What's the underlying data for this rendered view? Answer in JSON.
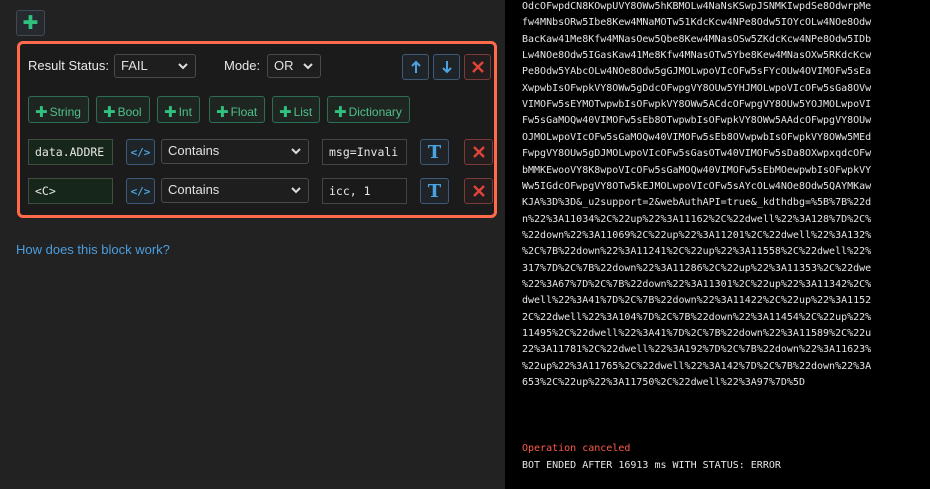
{
  "colors": {
    "accent_border": "#ff6b4a",
    "plus_green": "#2ec27e",
    "link_blue": "#4a9ee0",
    "error_red": "#ff5a4a",
    "rail": [
      "#f5c400",
      "#f5c400",
      "#27ae60",
      "#f5c400",
      "#2f8be6"
    ]
  },
  "icons": {
    "add": "plus-icon",
    "up": "arrow-up-icon",
    "down": "arrow-down-icon",
    "remove": "close-icon",
    "code": "code-icon",
    "text": "text-icon",
    "dropdown": "chevron-down-icon"
  },
  "block": {
    "result_status_label": "Result Status:",
    "result_status_value": "FAIL",
    "mode_label": "Mode:",
    "mode_value": "OR",
    "type_buttons": [
      "String",
      "Bool",
      "Int",
      "Float",
      "List",
      "Dictionary"
    ],
    "conditions": [
      {
        "variable": "data.ADDRE",
        "code_label": "</>",
        "comparison": "Contains",
        "value": "msg=Invali",
        "text_label": "T"
      },
      {
        "variable": "<C>",
        "code_label": "</>",
        "comparison": "Contains",
        "value": "icc, 1",
        "text_label": "T"
      }
    ],
    "help_link": "How does this block work?"
  },
  "console": {
    "lines": [
      "OdcOFwpdCN8KOwpUVY8OWw5hKBMOLw4NaNsKSwpJSNMKIwpdSe8OdwrpMe",
      "fw4MNbsORw5Ibe8Kew4MNaMOTw51KdcKcw4NPe8Odw5IOYcOLw4NOe8Odw",
      "BacKaw41Me8Kfw4MNasOew5Qbe8Kew4MNasOSw5ZKdcKcw4NPe8Odw5IDb",
      "Lw4NOe8Odw5IGasKaw41Me8Kfw4MNasOTw5Ybe8Kew4MNasOXw5RKdcKcw",
      "Pe8Odw5YAbcOLw4NOe8Odw5gGJMOLwpoVIcOFw5sFYcOUw4OVIMOFw5sEa",
      "XwpwbIsOFwpkVY8OWw5gDdcOFwpgVY8OUw5YHJMOLwpoVIcOFw5sGa8OVw",
      "VIMOFw5sEYMOTwpwbIsOFwpkVY8OWw5ACdcOFwpgVY8OUw5YOJMOLwpoVI",
      "Fw5sGaMOQw40VIMOFw5sEb8OTwpwbIsOFwpkVY8OWw5AAdcOFwpgVY8OUw",
      "OJMOLwpoVIcOFw5sGaMOQw40VIMOFw5sEb8OVwpwbIsOFwpkVY8OWw5MEd",
      "FwpgVY8OUw5gDJMOLwpoVIcOFw5sGasOTw40VIMOFw5sDa8OXwpxqdcOFw",
      "bMMKEwooVY8K8wpoVIcOFw5sGaMOQw40VIMOFw5sEbMOewpwbIsOFwpkVY",
      "Ww5IGdcOFwpgVY8OTw5kEJMOLwpoVIcOFw5sAYcOLw4NOe8Odw5QAYMKaw",
      "KJA%3D%3D&_u2support=2&webAuthAPI=true&_kdthdbg=%5B%7B%22d",
      "n%22%3A11034%2C%22up%22%3A11162%2C%22dwell%22%3A128%7D%2C%",
      "%22down%22%3A11069%2C%22up%22%3A11201%2C%22dwell%22%3A132%",
      "%2C%7B%22down%22%3A11241%2C%22up%22%3A11558%2C%22dwell%22%",
      "317%7D%2C%7B%22down%22%3A11286%2C%22up%22%3A11353%2C%22dwe",
      "%22%3A67%7D%2C%7B%22down%22%3A11301%2C%22up%22%3A11342%2C%",
      "dwell%22%3A41%7D%2C%7B%22down%22%3A11422%2C%22up%22%3A1152",
      "2C%22dwell%22%3A104%7D%2C%7B%22down%22%3A11454%2C%22up%22%",
      "11495%2C%22dwell%22%3A41%7D%2C%7B%22down%22%3A11589%2C%22u",
      "22%3A11781%2C%22dwell%22%3A192%7D%2C%7B%22down%22%3A11623%",
      "%22up%22%3A11765%2C%22dwell%22%3A142%7D%2C%7B%22down%22%3A",
      "653%2C%22up%22%3A11750%2C%22dwell%22%3A97%7D%5D"
    ],
    "error_line": "Operation canceled",
    "status_line": "BOT ENDED AFTER 16913 ms WITH STATUS: ERROR"
  }
}
